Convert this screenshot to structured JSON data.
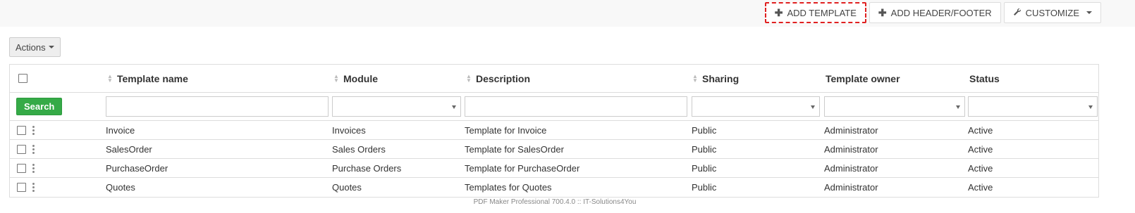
{
  "toolbar": {
    "add_template": "ADD TEMPLATE",
    "add_header_footer": "ADD HEADER/FOOTER",
    "customize": "CUSTOMIZE"
  },
  "actions_label": "Actions",
  "columns": {
    "template_name": "Template name",
    "module": "Module",
    "description": "Description",
    "sharing": "Sharing",
    "template_owner": "Template owner",
    "status": "Status"
  },
  "search_label": "Search",
  "rows": [
    {
      "name": "Invoice",
      "module": "Invoices",
      "description": "Template for Invoice",
      "sharing": "Public",
      "owner": "Administrator",
      "status": "Active"
    },
    {
      "name": "SalesOrder",
      "module": "Sales Orders",
      "description": "Template for SalesOrder",
      "sharing": "Public",
      "owner": "Administrator",
      "status": "Active"
    },
    {
      "name": "PurchaseOrder",
      "module": "Purchase Orders",
      "description": "Template for PurchaseOrder",
      "sharing": "Public",
      "owner": "Administrator",
      "status": "Active"
    },
    {
      "name": "Quotes",
      "module": "Quotes",
      "description": "Templates for Quotes",
      "sharing": "Public",
      "owner": "Administrator",
      "status": "Active"
    }
  ],
  "footer": "PDF Maker Professional 700.4.0 :: IT-Solutions4You",
  "colors": {
    "accent_green": "#35aa47",
    "highlight": "#e02020"
  }
}
